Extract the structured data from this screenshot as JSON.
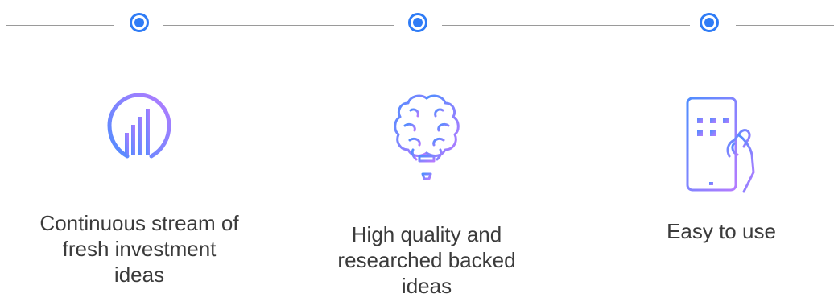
{
  "colors": {
    "accent": "#2f7cf6",
    "gradient_start": "#4f8dff",
    "gradient_end": "#b57bff",
    "line": "#9a9a9a",
    "text": "#3b3b3b"
  },
  "features": [
    {
      "icon": "lightbulb-chart-icon",
      "label": "Continuous stream of fresh investment ideas"
    },
    {
      "icon": "brain-bulb-icon",
      "label": "High quality and researched backed ideas"
    },
    {
      "icon": "smartphone-hand-icon",
      "label": "Easy to use"
    }
  ]
}
